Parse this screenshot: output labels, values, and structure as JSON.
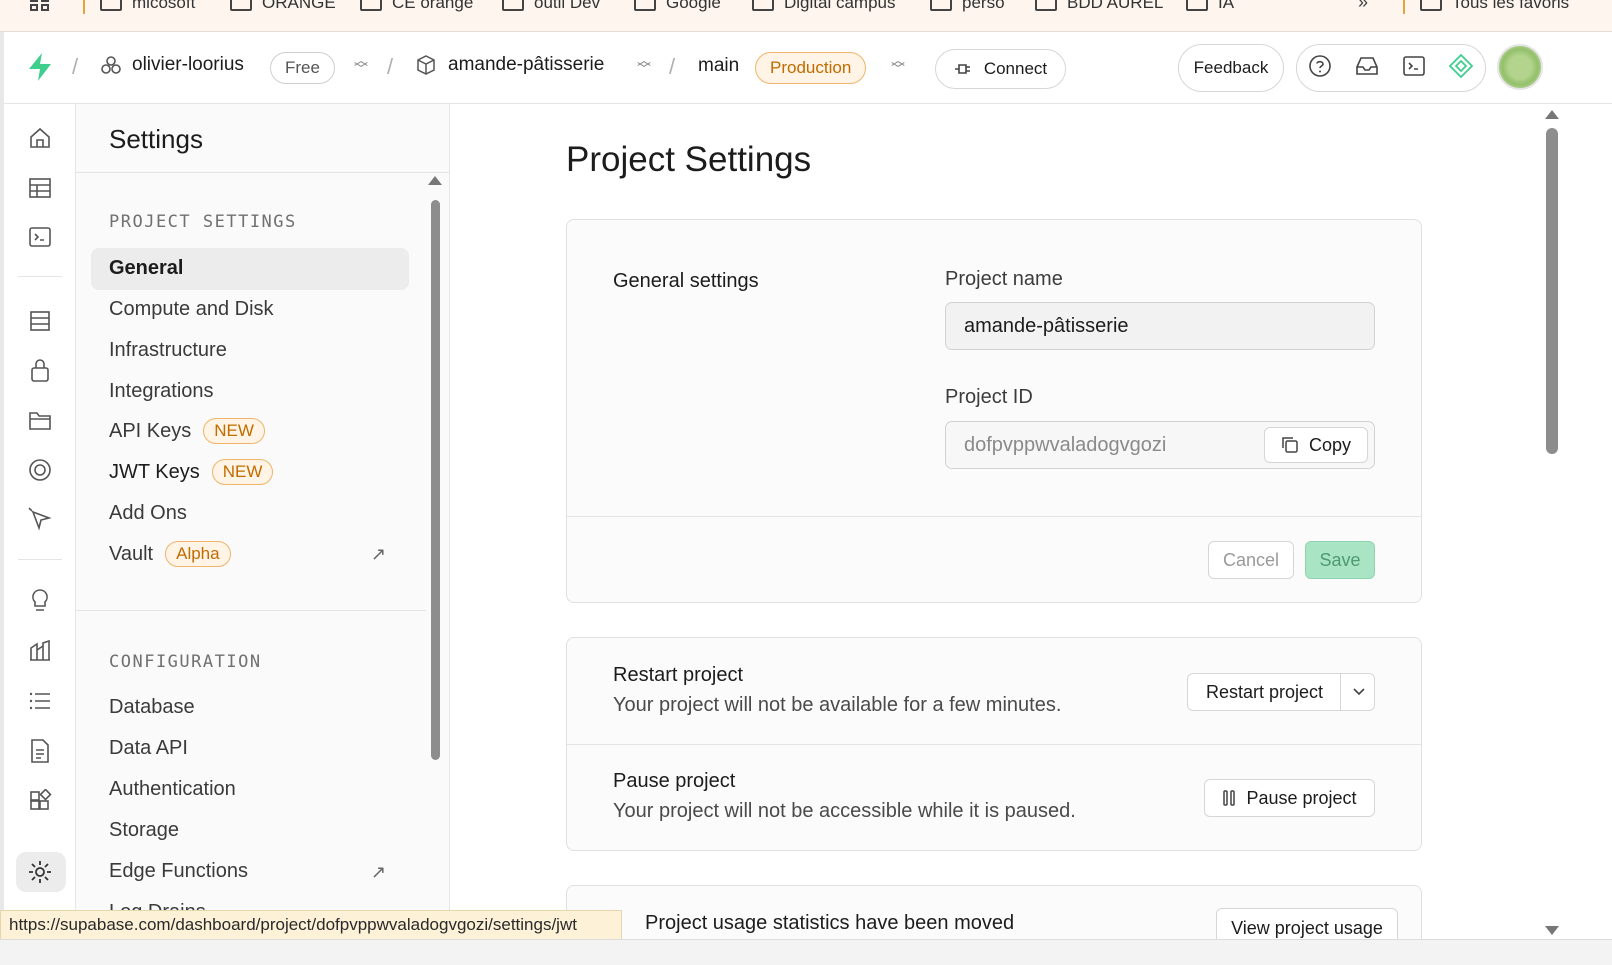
{
  "bookmarks": {
    "items": [
      "micosoft",
      "ORANGE",
      "CE orange",
      "outil Dev",
      "Google",
      "Digital campus",
      "perso",
      "BDD AUREL",
      "IA"
    ],
    "more": "»",
    "all_bookmarks": "Tous les favoris"
  },
  "topnav": {
    "org_name": "olivier-loorius",
    "org_plan": "Free",
    "project_name": "amande-pâtisserie",
    "branch": "main",
    "env_badge": "Production",
    "connect_label": "Connect",
    "feedback_label": "Feedback",
    "icons": [
      "help-icon",
      "inbox-icon",
      "terminal-icon",
      "assistant-icon"
    ]
  },
  "rail": {
    "icons": [
      "home-icon",
      "table-editor-icon",
      "sql-editor-icon",
      "database-icon",
      "auth-lock-icon",
      "storage-icon",
      "realtime-icon",
      "edge-functions-icon",
      "advisors-bulb-icon",
      "reports-icon",
      "logs-icon",
      "api-docs-icon",
      "integrations-icon",
      "settings-gear-icon"
    ]
  },
  "menu": {
    "title": "Settings",
    "project_section": "PROJECT SETTINGS",
    "project_items": [
      {
        "label": "General",
        "badge": ""
      },
      {
        "label": "Compute and Disk",
        "badge": ""
      },
      {
        "label": "Infrastructure",
        "badge": ""
      },
      {
        "label": "Integrations",
        "badge": ""
      },
      {
        "label": "API Keys",
        "badge": "NEW"
      },
      {
        "label": "JWT Keys",
        "badge": "NEW"
      },
      {
        "label": "Add Ons",
        "badge": ""
      },
      {
        "label": "Vault",
        "badge": "Alpha"
      }
    ],
    "config_section": "CONFIGURATION",
    "config_items": [
      "Database",
      "Data API",
      "Authentication",
      "Storage",
      "Edge Functions",
      "Log Drains"
    ]
  },
  "main": {
    "title": "Project Settings",
    "general": {
      "heading": "General settings",
      "name_label": "Project name",
      "name_value": "amande-pâtisserie",
      "id_label": "Project ID",
      "id_value": "dofpvppwvaladogvgozi",
      "copy_label": "Copy",
      "cancel_label": "Cancel",
      "save_label": "Save"
    },
    "restart": {
      "title": "Restart project",
      "desc": "Your project will not be available for a few minutes.",
      "button": "Restart project"
    },
    "pause": {
      "title": "Pause project",
      "desc": "Your project will not be accessible while it is paused.",
      "button": "Pause project"
    },
    "usage": {
      "title": "Project usage statistics have been moved",
      "button": "View project usage"
    }
  },
  "statusbar": {
    "url": "https://supabase.com/dashboard/project/dofpvppwvaladogvgozi/settings/jwt"
  },
  "colors": {
    "brand": "#3ecf8e",
    "badge_orange": "#c26b00",
    "save_green": "#a9e4c4"
  }
}
